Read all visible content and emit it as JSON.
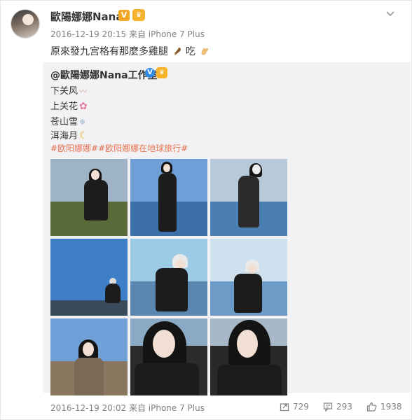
{
  "post": {
    "username": "歐陽娜娜Nana",
    "badge_v": "V",
    "badge_member": "♛",
    "time": "2016-12-19 20:15",
    "source": "来自 iPhone 7 Plus",
    "text": "原來發九宫格有那麼多雞腿",
    "text_tail": "吃"
  },
  "repost": {
    "author": "@歐陽娜娜Nana工作室",
    "badge_v": "V",
    "badge_member": "♛",
    "lines": [
      "下关风",
      "上关花",
      "苍山雪",
      "洱海月"
    ],
    "hashtags": "#欧阳娜娜##欧阳娜娜在地球旅行#",
    "photos": [
      {
        "sky": "#9fb3c6",
        "water": "#5a6b3a"
      },
      {
        "sky": "#6f9fd6",
        "water": "#3d6fa8"
      },
      {
        "sky": "#b8c9d9",
        "water": "#4b7fb3"
      },
      {
        "sky": "#3f7fc8",
        "water": "#3a4b5c"
      },
      {
        "sky": "#9ccbe6",
        "water": "#5a86b0"
      },
      {
        "sky": "#cfe0ee",
        "water": "#6b9bc6"
      },
      {
        "sky": "#6fa0d8",
        "water": "#8a7760"
      },
      {
        "sky": "#8aa9c4",
        "water": "#2d2a2a"
      },
      {
        "sky": "#a7b9c9",
        "water": "#2a2828"
      }
    ],
    "time": "2016-12-19 20:02",
    "source": "来自 iPhone 7 Plus",
    "reposts": "729",
    "comments": "293",
    "likes": "1938"
  },
  "colors": {
    "link": "#eb7350",
    "meta": "#808080",
    "verify_orange": "#f5a623",
    "verify_blue": "#2e8ce6"
  },
  "icons": [
    "chevron-down-icon",
    "repost-icon",
    "comment-icon",
    "like-icon"
  ]
}
